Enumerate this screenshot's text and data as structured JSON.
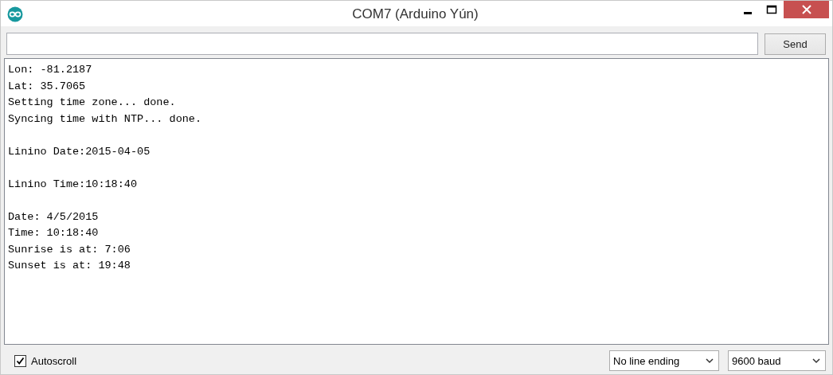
{
  "window": {
    "title": "COM7 (Arduino Yún)"
  },
  "input_row": {
    "send_button": "Send"
  },
  "output": {
    "paragraphs": [
      [
        "Lon: -81.2187",
        "Lat: 35.7065",
        "Setting time zone... done.",
        "Syncing time with NTP... done."
      ],
      [
        "Linino Date:2015-04-05"
      ],
      [
        "Linino Time:10:18:40"
      ],
      [
        "Date: 4/5/2015",
        "Time: 10:18:40",
        "Sunrise is at: 7:06",
        "Sunset is at: 19:48"
      ]
    ]
  },
  "footer": {
    "autoscroll": {
      "label": "Autoscroll",
      "checked": true
    },
    "dropdowns": [
      {
        "value": "No line ending"
      },
      {
        "value": "9600 baud"
      }
    ]
  }
}
